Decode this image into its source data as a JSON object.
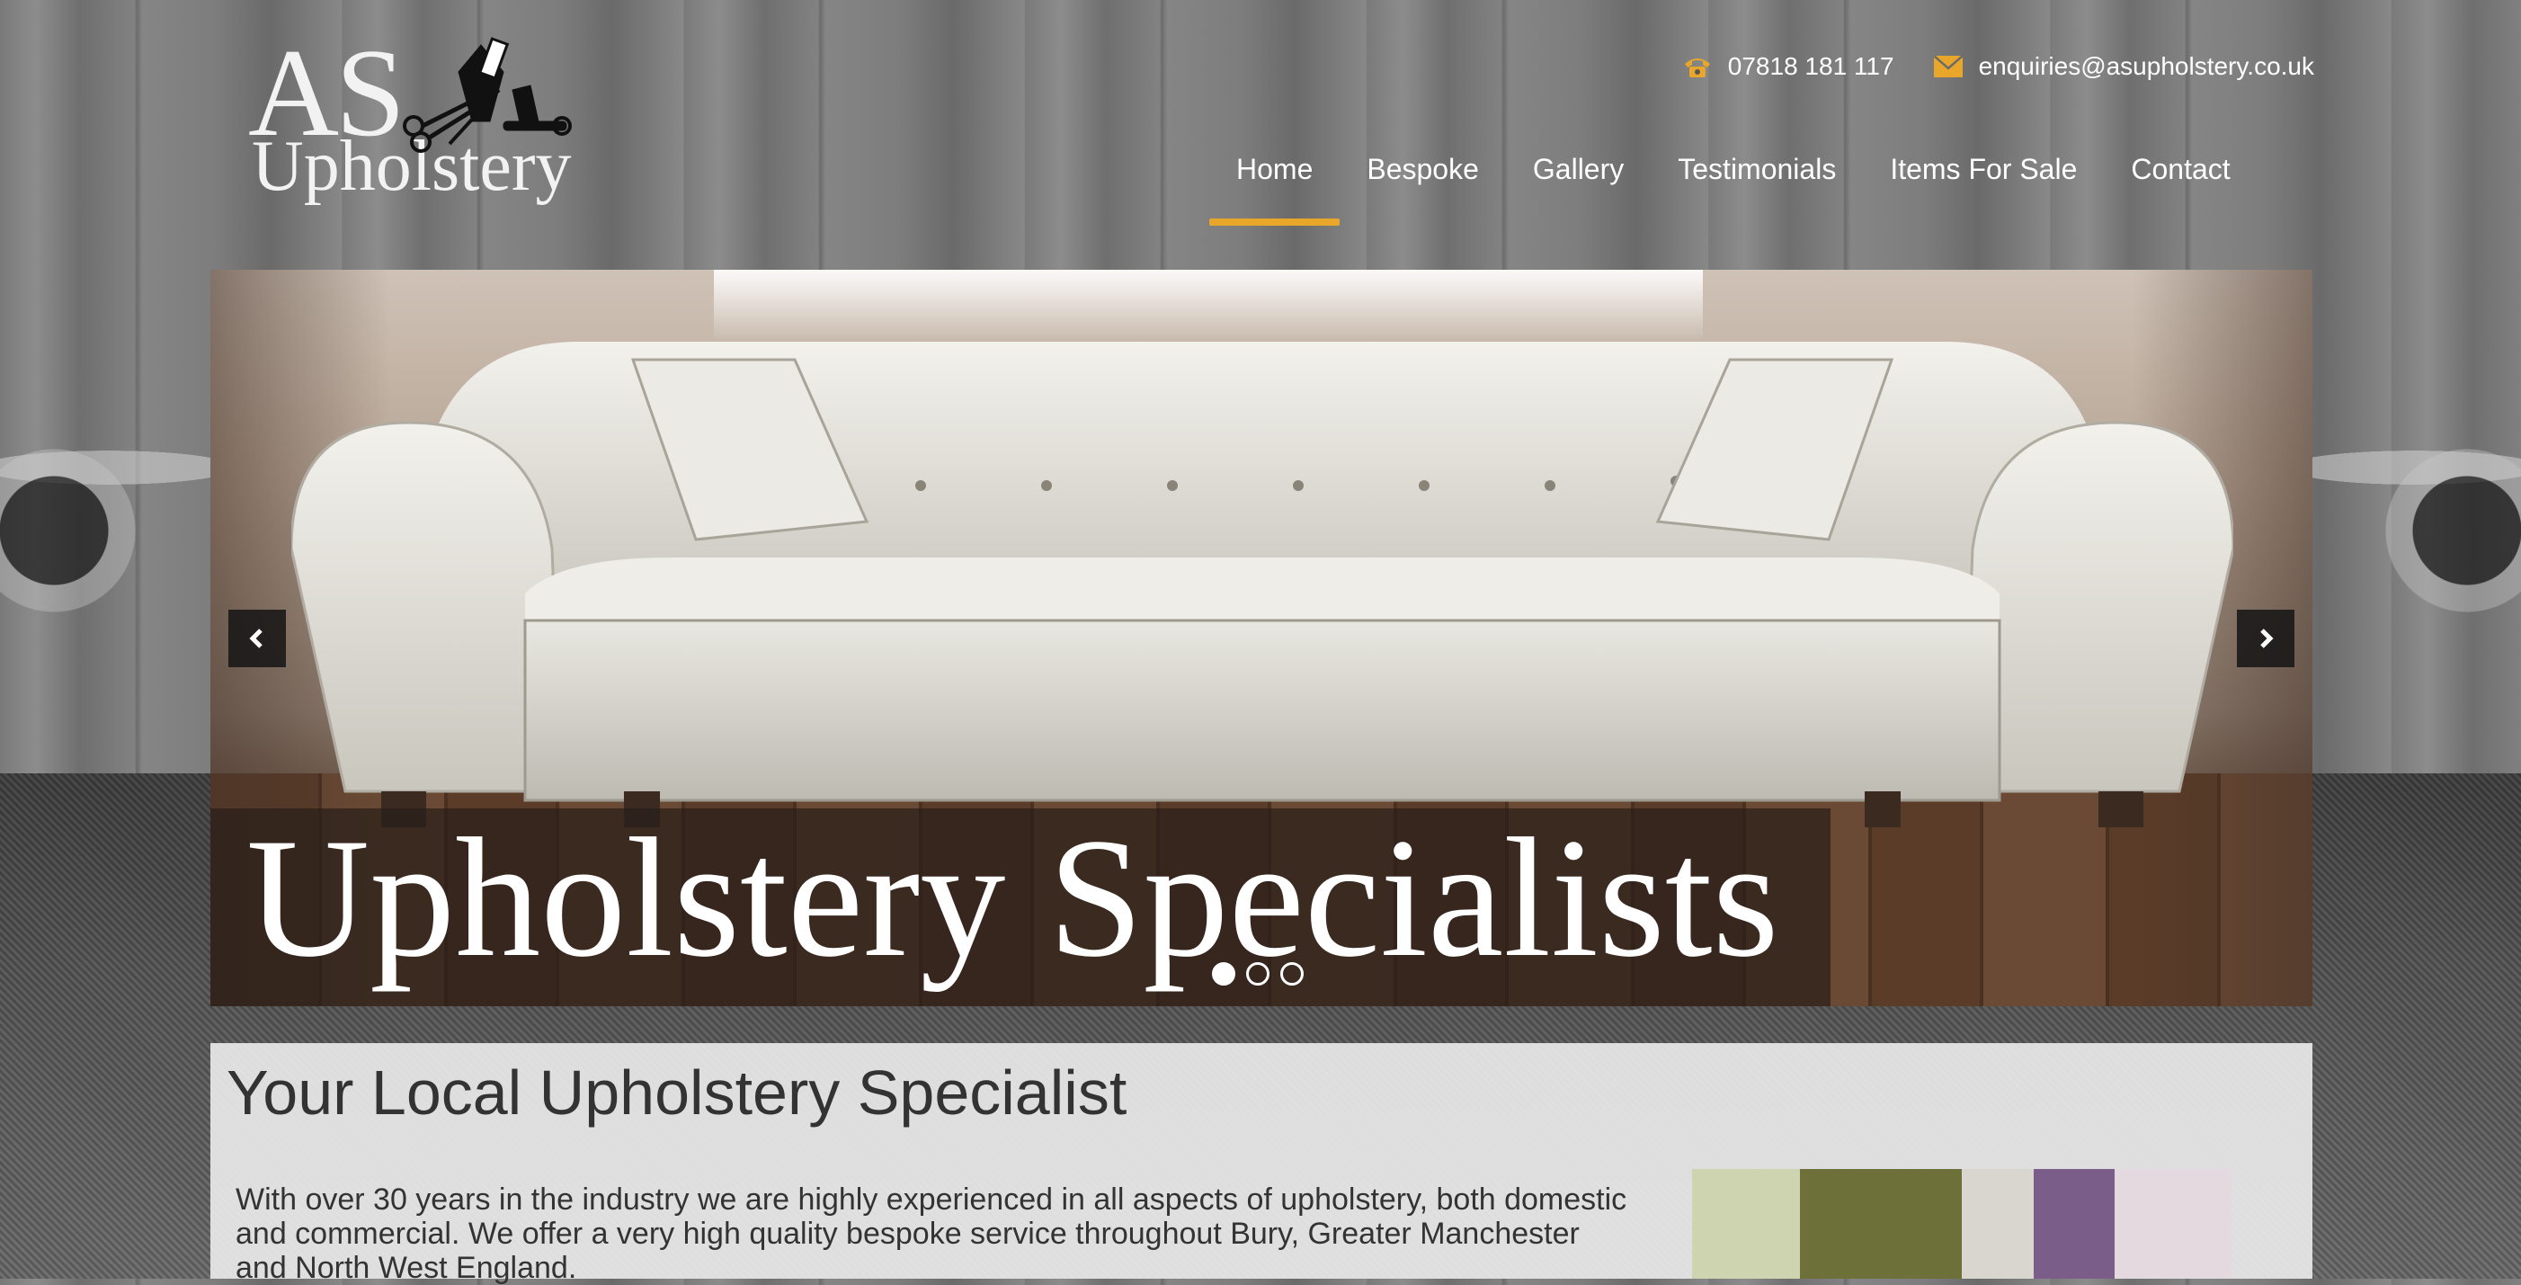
{
  "site": {
    "logo_line1": "AS",
    "logo_line2": "Upholstery"
  },
  "contact": {
    "phone": "07818 181 117",
    "email": "enquiries@asupholstery.co.uk",
    "icon_color": "#e8a62a"
  },
  "nav": {
    "items": [
      "Home",
      "Bespoke",
      "Gallery",
      "Testimonials",
      "Items For Sale",
      "Contact"
    ],
    "active": "Home",
    "active_color": "#e8a62a"
  },
  "slider": {
    "caption": "Upholstery Specialists",
    "slide_count": 3,
    "active_slide": 1,
    "prev_icon": "chevron-left-icon",
    "next_icon": "chevron-right-icon"
  },
  "intro": {
    "heading": "Your Local Upholstery Specialist",
    "body": "With over 30 years in the industry we are highly experienced in all aspects of upholstery, both domestic and commercial. We offer a very high quality bespoke service throughout Bury, Greater Manchester and North West England."
  }
}
